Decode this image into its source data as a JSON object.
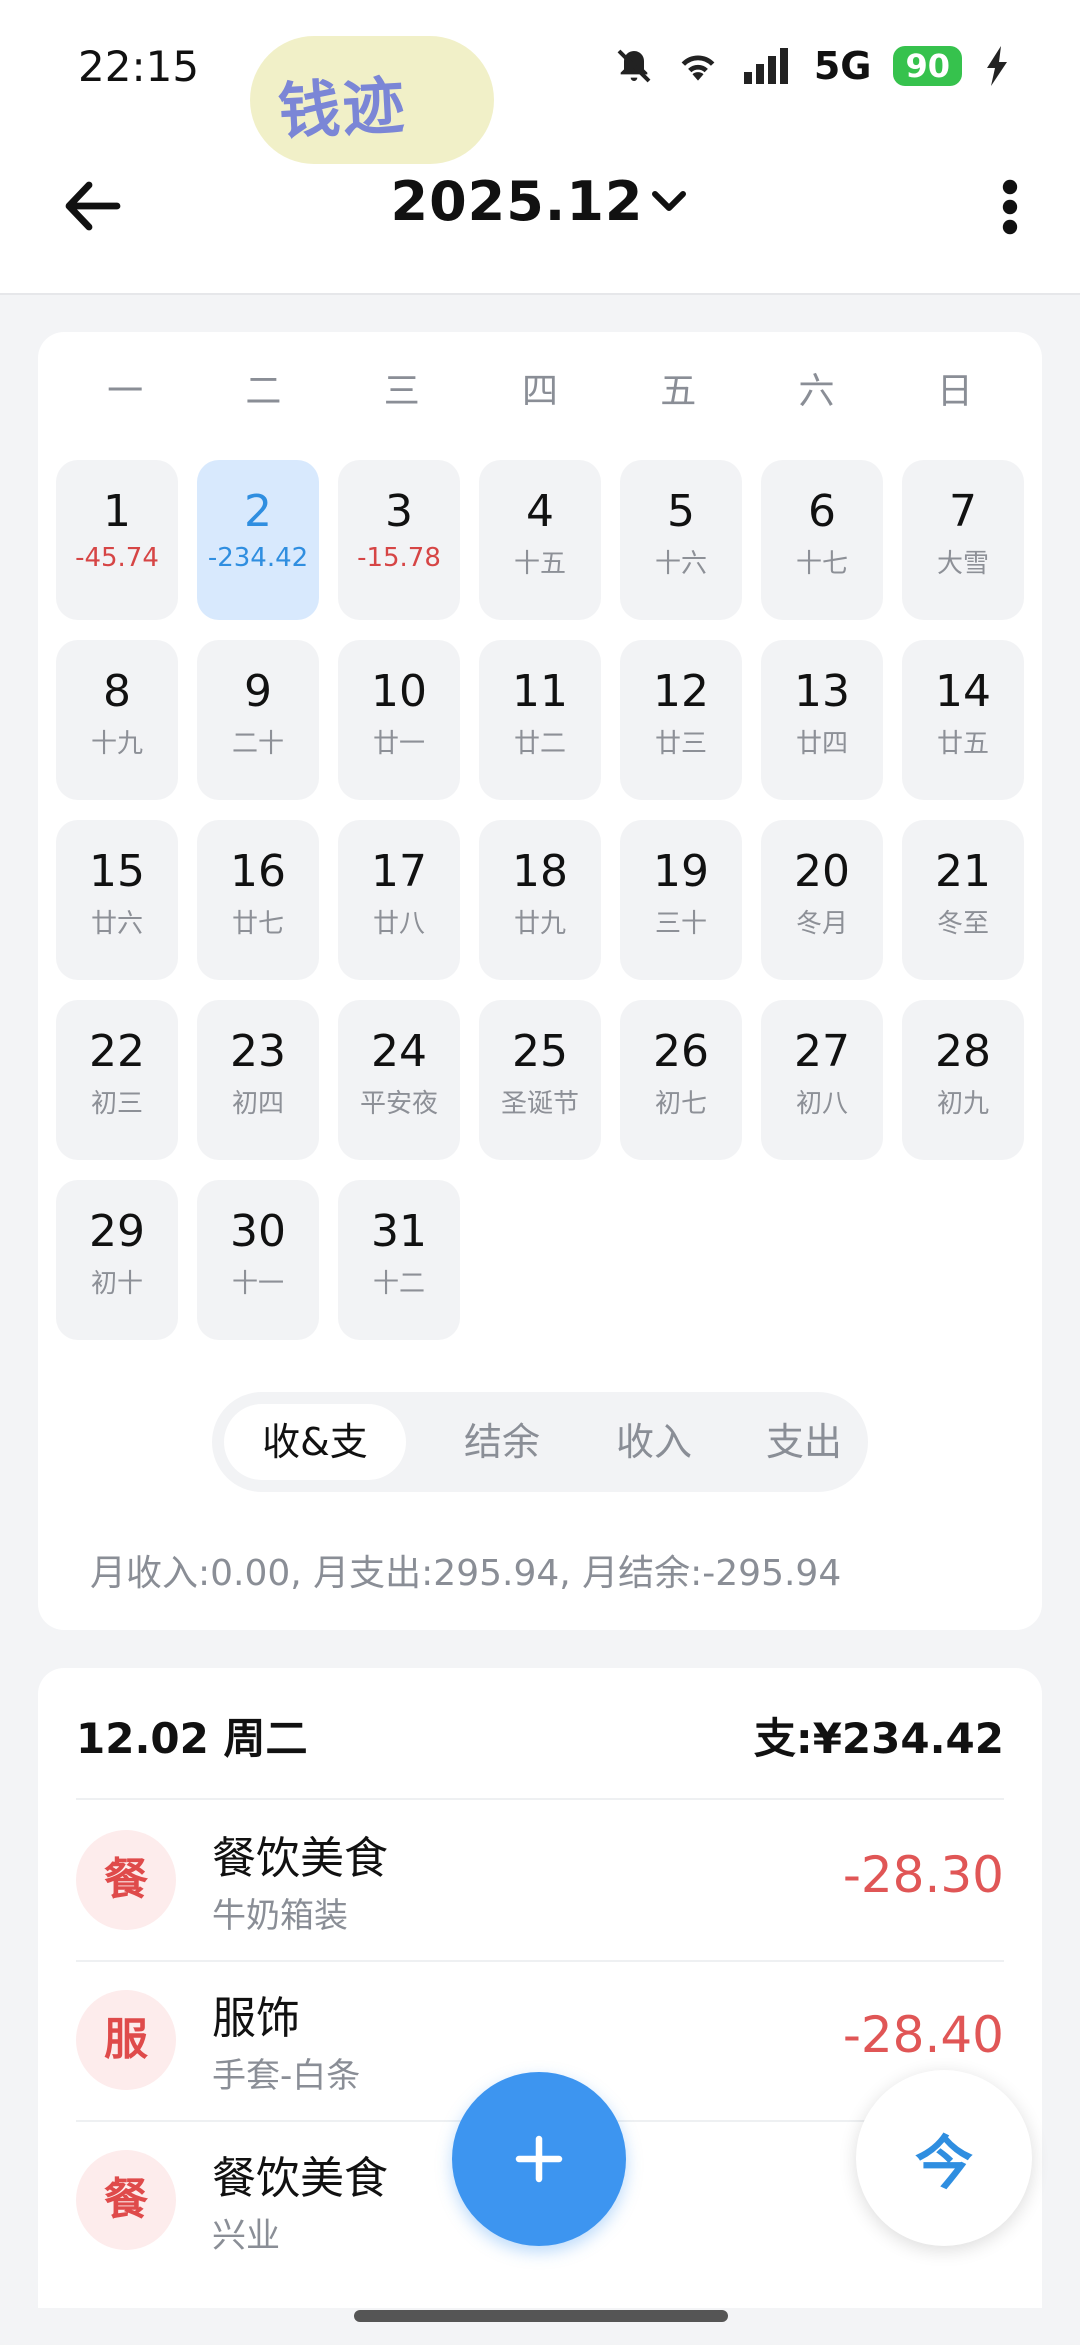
{
  "status": {
    "time": "22:15",
    "network": "5G",
    "battery": "90"
  },
  "logo": {
    "text": "钱迹"
  },
  "header": {
    "title": "2025.12"
  },
  "calendar": {
    "weekdays": [
      "一",
      "二",
      "三",
      "四",
      "五",
      "六",
      "日"
    ],
    "days": [
      {
        "num": "1",
        "sub": "-45.74",
        "type": "expense"
      },
      {
        "num": "2",
        "sub": "-234.42",
        "type": "expense",
        "selected": true
      },
      {
        "num": "3",
        "sub": "-15.78",
        "type": "expense"
      },
      {
        "num": "4",
        "sub": "十五"
      },
      {
        "num": "5",
        "sub": "十六"
      },
      {
        "num": "6",
        "sub": "十七"
      },
      {
        "num": "7",
        "sub": "大雪"
      },
      {
        "num": "8",
        "sub": "十九"
      },
      {
        "num": "9",
        "sub": "二十"
      },
      {
        "num": "10",
        "sub": "廿一"
      },
      {
        "num": "11",
        "sub": "廿二"
      },
      {
        "num": "12",
        "sub": "廿三"
      },
      {
        "num": "13",
        "sub": "廿四"
      },
      {
        "num": "14",
        "sub": "廿五"
      },
      {
        "num": "15",
        "sub": "廿六"
      },
      {
        "num": "16",
        "sub": "廿七"
      },
      {
        "num": "17",
        "sub": "廿八"
      },
      {
        "num": "18",
        "sub": "廿九"
      },
      {
        "num": "19",
        "sub": "三十"
      },
      {
        "num": "20",
        "sub": "冬月"
      },
      {
        "num": "21",
        "sub": "冬至"
      },
      {
        "num": "22",
        "sub": "初三"
      },
      {
        "num": "23",
        "sub": "初四"
      },
      {
        "num": "24",
        "sub": "平安夜"
      },
      {
        "num": "25",
        "sub": "圣诞节"
      },
      {
        "num": "26",
        "sub": "初七"
      },
      {
        "num": "27",
        "sub": "初八"
      },
      {
        "num": "28",
        "sub": "初九"
      },
      {
        "num": "29",
        "sub": "初十"
      },
      {
        "num": "30",
        "sub": "十一"
      },
      {
        "num": "31",
        "sub": "十二"
      }
    ]
  },
  "segments": {
    "items": [
      "收&支",
      "结余",
      "收入",
      "支出"
    ],
    "active": "收&支"
  },
  "summary": "月收入:0.00, 月支出:295.94, 月结余:-295.94",
  "records": {
    "date": "12.02 周二",
    "total": "支:¥234.42",
    "items": [
      {
        "badge": "餐",
        "category": "餐饮美食",
        "note": "牛奶箱装",
        "amount": "-28.30"
      },
      {
        "badge": "服",
        "category": "服饰",
        "note": "手套-白条",
        "amount": "-28.40"
      },
      {
        "badge": "餐",
        "category": "餐饮美食",
        "note": "兴业",
        "amount": ""
      }
    ]
  },
  "fab": {
    "today_label": "今"
  },
  "colors": {
    "accent": "#3d95f0",
    "expense": "#e05656",
    "selected_bg": "#d8e9fd"
  }
}
